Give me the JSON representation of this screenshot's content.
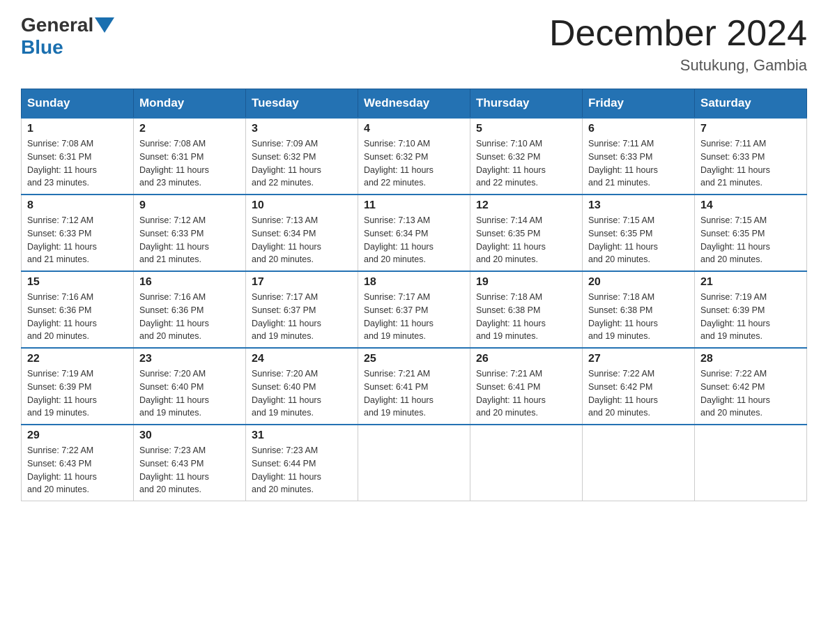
{
  "header": {
    "logo_general": "General",
    "logo_blue": "Blue",
    "month_title": "December 2024",
    "location": "Sutukung, Gambia"
  },
  "calendar": {
    "days_of_week": [
      "Sunday",
      "Monday",
      "Tuesday",
      "Wednesday",
      "Thursday",
      "Friday",
      "Saturday"
    ],
    "weeks": [
      [
        {
          "day": "1",
          "sunrise": "7:08 AM",
          "sunset": "6:31 PM",
          "daylight": "11 hours and 23 minutes."
        },
        {
          "day": "2",
          "sunrise": "7:08 AM",
          "sunset": "6:31 PM",
          "daylight": "11 hours and 23 minutes."
        },
        {
          "day": "3",
          "sunrise": "7:09 AM",
          "sunset": "6:32 PM",
          "daylight": "11 hours and 22 minutes."
        },
        {
          "day": "4",
          "sunrise": "7:10 AM",
          "sunset": "6:32 PM",
          "daylight": "11 hours and 22 minutes."
        },
        {
          "day": "5",
          "sunrise": "7:10 AM",
          "sunset": "6:32 PM",
          "daylight": "11 hours and 22 minutes."
        },
        {
          "day": "6",
          "sunrise": "7:11 AM",
          "sunset": "6:33 PM",
          "daylight": "11 hours and 21 minutes."
        },
        {
          "day": "7",
          "sunrise": "7:11 AM",
          "sunset": "6:33 PM",
          "daylight": "11 hours and 21 minutes."
        }
      ],
      [
        {
          "day": "8",
          "sunrise": "7:12 AM",
          "sunset": "6:33 PM",
          "daylight": "11 hours and 21 minutes."
        },
        {
          "day": "9",
          "sunrise": "7:12 AM",
          "sunset": "6:33 PM",
          "daylight": "11 hours and 21 minutes."
        },
        {
          "day": "10",
          "sunrise": "7:13 AM",
          "sunset": "6:34 PM",
          "daylight": "11 hours and 20 minutes."
        },
        {
          "day": "11",
          "sunrise": "7:13 AM",
          "sunset": "6:34 PM",
          "daylight": "11 hours and 20 minutes."
        },
        {
          "day": "12",
          "sunrise": "7:14 AM",
          "sunset": "6:35 PM",
          "daylight": "11 hours and 20 minutes."
        },
        {
          "day": "13",
          "sunrise": "7:15 AM",
          "sunset": "6:35 PM",
          "daylight": "11 hours and 20 minutes."
        },
        {
          "day": "14",
          "sunrise": "7:15 AM",
          "sunset": "6:35 PM",
          "daylight": "11 hours and 20 minutes."
        }
      ],
      [
        {
          "day": "15",
          "sunrise": "7:16 AM",
          "sunset": "6:36 PM",
          "daylight": "11 hours and 20 minutes."
        },
        {
          "day": "16",
          "sunrise": "7:16 AM",
          "sunset": "6:36 PM",
          "daylight": "11 hours and 20 minutes."
        },
        {
          "day": "17",
          "sunrise": "7:17 AM",
          "sunset": "6:37 PM",
          "daylight": "11 hours and 19 minutes."
        },
        {
          "day": "18",
          "sunrise": "7:17 AM",
          "sunset": "6:37 PM",
          "daylight": "11 hours and 19 minutes."
        },
        {
          "day": "19",
          "sunrise": "7:18 AM",
          "sunset": "6:38 PM",
          "daylight": "11 hours and 19 minutes."
        },
        {
          "day": "20",
          "sunrise": "7:18 AM",
          "sunset": "6:38 PM",
          "daylight": "11 hours and 19 minutes."
        },
        {
          "day": "21",
          "sunrise": "7:19 AM",
          "sunset": "6:39 PM",
          "daylight": "11 hours and 19 minutes."
        }
      ],
      [
        {
          "day": "22",
          "sunrise": "7:19 AM",
          "sunset": "6:39 PM",
          "daylight": "11 hours and 19 minutes."
        },
        {
          "day": "23",
          "sunrise": "7:20 AM",
          "sunset": "6:40 PM",
          "daylight": "11 hours and 19 minutes."
        },
        {
          "day": "24",
          "sunrise": "7:20 AM",
          "sunset": "6:40 PM",
          "daylight": "11 hours and 19 minutes."
        },
        {
          "day": "25",
          "sunrise": "7:21 AM",
          "sunset": "6:41 PM",
          "daylight": "11 hours and 19 minutes."
        },
        {
          "day": "26",
          "sunrise": "7:21 AM",
          "sunset": "6:41 PM",
          "daylight": "11 hours and 20 minutes."
        },
        {
          "day": "27",
          "sunrise": "7:22 AM",
          "sunset": "6:42 PM",
          "daylight": "11 hours and 20 minutes."
        },
        {
          "day": "28",
          "sunrise": "7:22 AM",
          "sunset": "6:42 PM",
          "daylight": "11 hours and 20 minutes."
        }
      ],
      [
        {
          "day": "29",
          "sunrise": "7:22 AM",
          "sunset": "6:43 PM",
          "daylight": "11 hours and 20 minutes."
        },
        {
          "day": "30",
          "sunrise": "7:23 AM",
          "sunset": "6:43 PM",
          "daylight": "11 hours and 20 minutes."
        },
        {
          "day": "31",
          "sunrise": "7:23 AM",
          "sunset": "6:44 PM",
          "daylight": "11 hours and 20 minutes."
        },
        null,
        null,
        null,
        null
      ]
    ],
    "labels": {
      "sunrise": "Sunrise:",
      "sunset": "Sunset:",
      "daylight": "Daylight:"
    }
  }
}
